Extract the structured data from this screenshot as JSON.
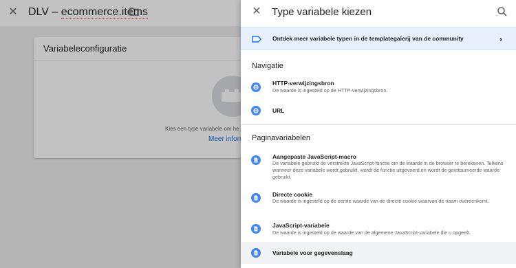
{
  "background": {
    "title_prefix": "DLV – ",
    "title_main": "ecommerce.items",
    "card_title": "Variabeleconfiguratie",
    "hint_text": "Kies een type variabele om he",
    "link_text": "Meer inforn"
  },
  "panel": {
    "title": "Type variabele kiezen",
    "community_text": "Ontdek meer variabele typen in de templategalerij van de community",
    "sections": {
      "navigatie": "Navigatie",
      "pagina": "Paginavariabelen"
    },
    "items": [
      {
        "name": "HTTP-verwijzingsbron",
        "desc": "De waarde is ingesteld op de HTTP-verwijzingsbron.",
        "icon": "globe-icon"
      },
      {
        "name": "URL",
        "desc": "",
        "icon": "globe-icon"
      },
      {
        "name": "Aangepaste JavaScript-macro",
        "desc": "De variabele gebruikt de verstrekte JavaScript-functie om de waarde in de browser te berekenen. Telkens wanneer deze variabele wordt gebruikt, wordt de functie uitgevoerd en wordt de geretourneerde waarde gebruikt.",
        "icon": "document-icon"
      },
      {
        "name": "Directe cookie",
        "desc": "De waarde is ingesteld op de eerste waarde van de directe cookie waarvan de naam overeenkomt.",
        "icon": "document-icon"
      },
      {
        "name": "JavaScript-variabele",
        "desc": "De waarde is ingesteld op de waarde van de algemene JavaScript-variabele die u opgeeft.",
        "icon": "document-icon"
      },
      {
        "name": "Variabele voor gegevenslaag",
        "desc": "",
        "icon": "document-icon"
      }
    ]
  },
  "colors": {
    "accent": "#4285f4",
    "link": "#1a73e8",
    "highlight": "#e8f0fe"
  }
}
